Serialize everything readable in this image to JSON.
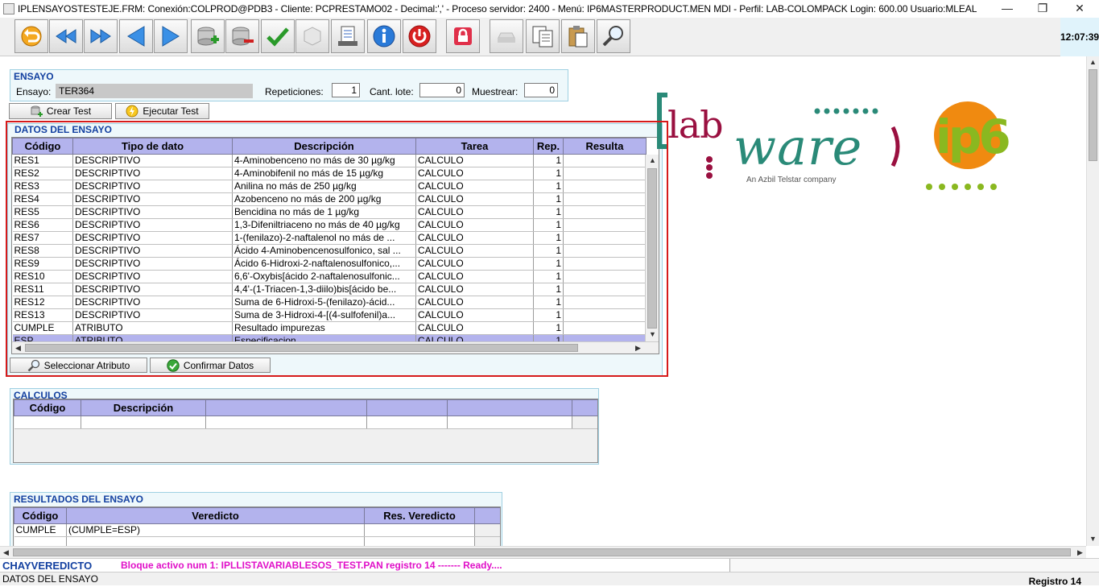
{
  "window": {
    "title": "IPLENSAYOSTESTEJE.FRM:        Conexión:COLPROD@PDB3 - Cliente: PCPRESTAMO02 - Decimal:',' - Proceso servidor: 2400 - Menú: IP6MASTERPRODUCT.MEN MDI - Perfil: LAB-COLOMPACK Login: 600.00        Usuario:MLEAL",
    "minimize": "—",
    "maximize": "❐",
    "close": "✕"
  },
  "toolbar": {
    "clock": "12:07:39",
    "buttons": [
      "undo-icon",
      "first-record-icon",
      "next-record-icon",
      "previous-icon",
      "next-icon",
      "add-record-icon",
      "delete-record-icon",
      "check-icon",
      "box-icon",
      "print-icon",
      "info-icon",
      "power-icon",
      "lock-icon",
      "disabled-icon",
      "copy-icon",
      "paste-icon",
      "search-icon"
    ]
  },
  "ensayo": {
    "title": "ENSAYO",
    "label": "Ensayo:",
    "value": "TER364",
    "repeticiones_label": "Repeticiones:",
    "repeticiones": "1",
    "cant_lote_label": "Cant. lote:",
    "cant_lote": "0",
    "muestrear_label": "Muestrear:",
    "muestrear": "0",
    "crear_test": "Crear Test",
    "ejecutar_test": "Ejecutar Test"
  },
  "datos": {
    "title": "DATOS DEL ENSAYO",
    "columns": [
      "Código",
      "Tipo de dato",
      "Descripción",
      "Tarea",
      "Rep.",
      "Resulta"
    ],
    "rows": [
      [
        "RES1",
        "DESCRIPTIVO",
        "4-Aminobenceno no más de 30 µg/kg",
        "CALCULO",
        "1",
        ""
      ],
      [
        "RES2",
        "DESCRIPTIVO",
        "4-Aminobifenil no más de 15 µg/kg",
        "CALCULO",
        "1",
        ""
      ],
      [
        "RES3",
        "DESCRIPTIVO",
        "Anilina no más de 250 µg/kg",
        "CALCULO",
        "1",
        ""
      ],
      [
        "RES4",
        "DESCRIPTIVO",
        "Azobenceno no más de 200 µg/kg",
        "CALCULO",
        "1",
        ""
      ],
      [
        "RES5",
        "DESCRIPTIVO",
        "Bencidina no más de 1 µg/kg",
        "CALCULO",
        "1",
        ""
      ],
      [
        "RES6",
        "DESCRIPTIVO",
        "1,3-Difeniltriaceno no más de 40 µg/kg",
        "CALCULO",
        "1",
        ""
      ],
      [
        "RES7",
        "DESCRIPTIVO",
        "1-(fenilazo)-2-naftalenol no más de ...",
        "CALCULO",
        "1",
        ""
      ],
      [
        "RES8",
        "DESCRIPTIVO",
        "Ácido 4-Aminobencenosulfonico, sal ...",
        "CALCULO",
        "1",
        ""
      ],
      [
        "RES9",
        "DESCRIPTIVO",
        "Ácido 6-Hidroxi-2-naftalenosulfonico,...",
        "CALCULO",
        "1",
        ""
      ],
      [
        "RES10",
        "DESCRIPTIVO",
        "6,6'-Oxybis[ácido 2-naftalenosulfonic...",
        "CALCULO",
        "1",
        ""
      ],
      [
        "RES11",
        "DESCRIPTIVO",
        "4,4'-(1-Triacen-1,3-diilo)bis[ácido be...",
        "CALCULO",
        "1",
        ""
      ],
      [
        "RES12",
        "DESCRIPTIVO",
        "Suma de 6-Hidroxi-5-(fenilazo)-ácid...",
        "CALCULO",
        "1",
        ""
      ],
      [
        "RES13",
        "DESCRIPTIVO",
        "Suma de 3-Hidroxi-4-[(4-sulfofenil)a...",
        "CALCULO",
        "1",
        ""
      ],
      [
        "CUMPLE",
        "ATRIBUTO",
        "Resultado impurezas",
        "CALCULO",
        "1",
        ""
      ],
      [
        "ESP",
        "ATRIBUTO",
        "Especificacion",
        "CALCULO",
        "1",
        ""
      ]
    ],
    "seleccionar_atributo": "Seleccionar Atributo",
    "confirmar_datos": "Confirmar Datos"
  },
  "calculos": {
    "title": "CALCULOS",
    "columns": [
      "Código",
      "Descripción",
      "",
      "",
      ""
    ]
  },
  "resultados": {
    "title": "RESULTADOS DEL ENSAYO",
    "columns": [
      "Código",
      "Veredicto",
      "Res. Veredicto"
    ],
    "rows": [
      [
        "CUMPLE",
        "(CUMPLE=ESP)",
        ""
      ]
    ]
  },
  "logo": {
    "lab": "lab",
    "ware": "ware",
    "tagline": "An Azbil Telstar company",
    "ip6": "ip6"
  },
  "status": {
    "left": "CHAYVEREDICTO",
    "message": "Bloque activo num 1: IPLLISTAVARIABLESOS_TEST.PAN  registro 14 ------- Ready....",
    "block": "DATOS DEL ENSAYO",
    "registro": "Registro 14"
  },
  "colors": {
    "accent_blue": "#1340a0",
    "header_purple": "#b3b3ed",
    "status_magenta": "#e010c8",
    "highlight_red": "#d61a1a",
    "labware_teal": "#2a8a78",
    "labware_red": "#9a1040",
    "ip6_orange": "#f08a10",
    "ip6_green": "#8ab820"
  }
}
